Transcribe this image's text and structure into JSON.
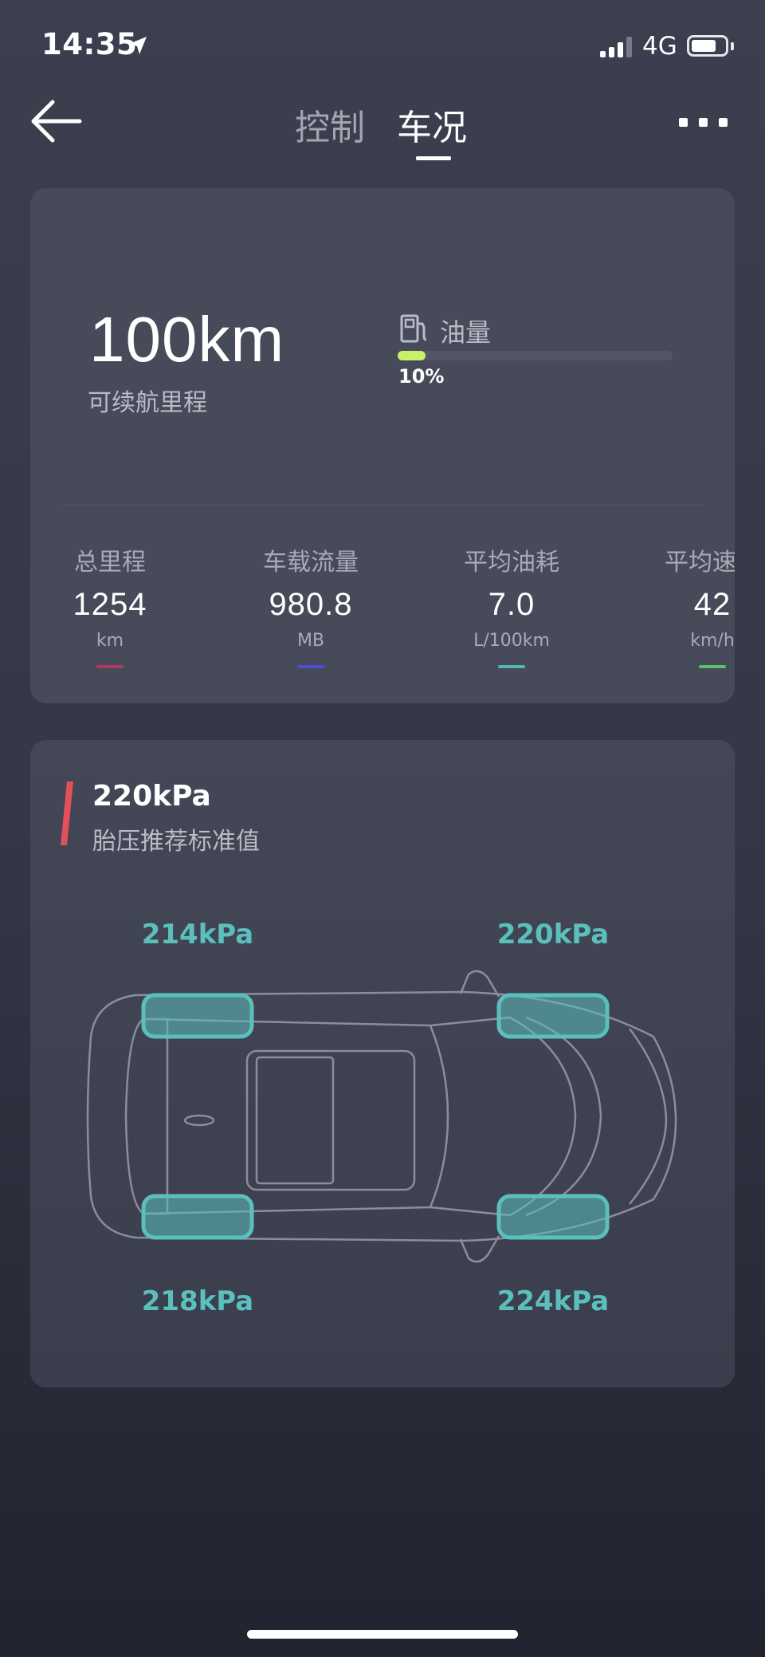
{
  "status_bar": {
    "time": "14:35",
    "network": "4G",
    "battery_level": 0.75,
    "icons": [
      "location-arrow-icon",
      "signal-icon",
      "battery-icon"
    ]
  },
  "nav": {
    "back_icon": "back-arrow-icon",
    "tabs": [
      {
        "label": "控制",
        "active": false
      },
      {
        "label": "车况",
        "active": true
      }
    ],
    "more_icon": "more-dots-icon"
  },
  "summary": {
    "range_value": "100km",
    "range_label": "可续航里程",
    "fuel_label": "油量",
    "fuel_icon": "fuel-pump-icon",
    "fuel_percent_text": "10%",
    "fuel_level": 0.1,
    "fuel_bar_color": "#c8f06a",
    "stats": [
      {
        "label": "总里程",
        "value": "1254",
        "unit": "km",
        "color": "#b03a5e"
      },
      {
        "label": "车载流量",
        "value": "980.8",
        "unit": "MB",
        "color": "#4a4ed8"
      },
      {
        "label": "平均油耗",
        "value": "7.0",
        "unit": "L/100km",
        "color": "#4fb8b8"
      },
      {
        "label": "平均速度",
        "value": "42",
        "unit": "km/h",
        "color": "#5cc06a"
      }
    ]
  },
  "tires": {
    "standard_value": "220kPa",
    "standard_label": "胎压推荐标准值",
    "accent_color": "#e4505a",
    "tire_color": "#5bc0bd",
    "front_left": "214kPa",
    "front_right": "220kPa",
    "rear_left": "218kPa",
    "rear_right": "224kPa"
  }
}
